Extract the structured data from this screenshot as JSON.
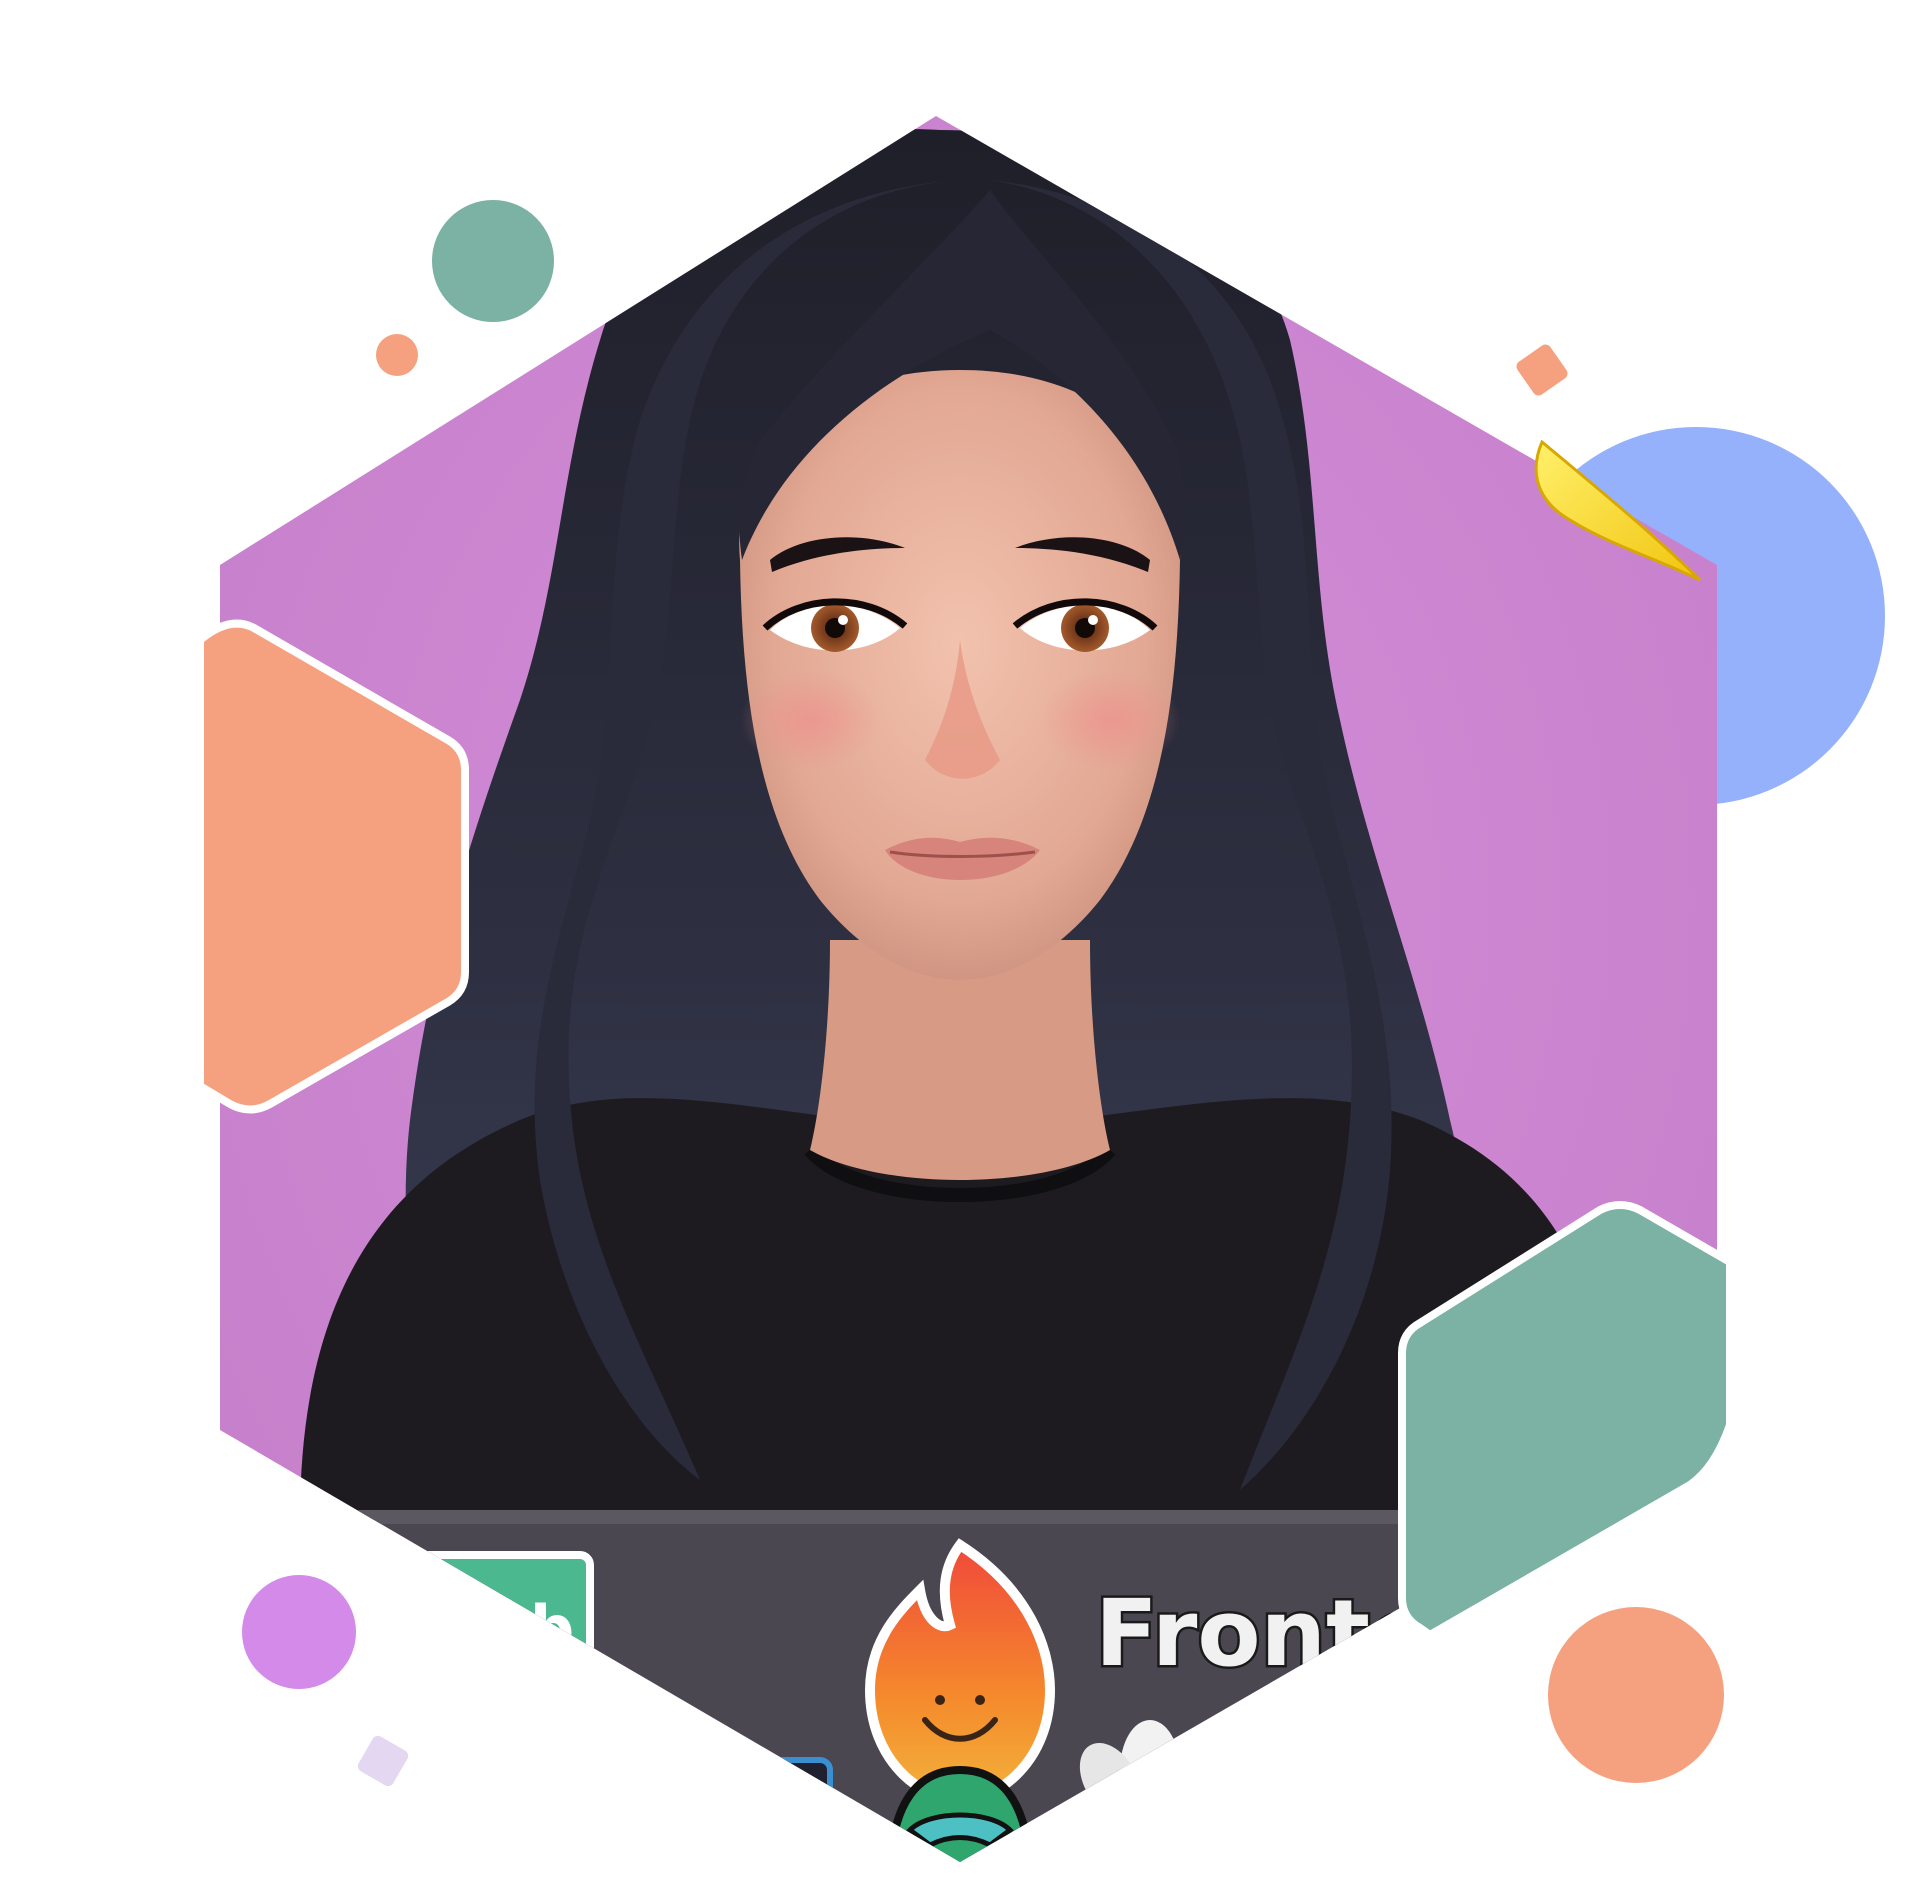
{
  "colors": {
    "background": "#ffffff",
    "main_hexagon": "#cc85d0",
    "orange_hexagon": "#f5a07e",
    "green_hexagon": "#7bb2a3",
    "blue_circle": "#96b1fb",
    "green_dot": "#7bb2a3",
    "orange_dot": "#f5a07e",
    "orange_diamond": "#f5a07e",
    "purple_dot": "#d38ae8",
    "lavender_diamond": "#e4d7f1",
    "yellow_leaf": "#f5d51e",
    "hair": "#23242f",
    "skin": "#e8b49f",
    "shirt": "#1d1b1f",
    "laptop": "#4a4751"
  },
  "icons": {
    "fire_sticker": "fire-smile-icon",
    "flower_sticker": "lotus-icon",
    "helmet_sticker": "helmet-icon"
  },
  "stickers": {
    "left_fragment": "ub",
    "frontend": "Fronten"
  }
}
